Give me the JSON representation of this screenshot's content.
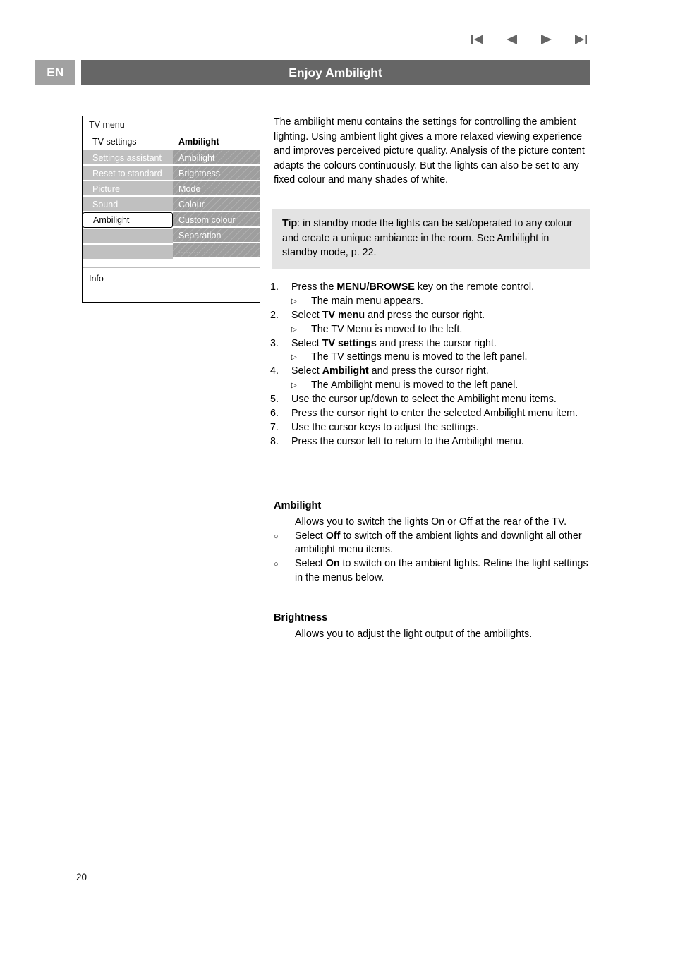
{
  "nav": {
    "icons": [
      {
        "name": "skip-first-icon",
        "label": "First page"
      },
      {
        "name": "previous-icon",
        "label": "Previous page"
      },
      {
        "name": "next-icon",
        "label": "Next page"
      },
      {
        "name": "skip-last-icon",
        "label": "Last page"
      }
    ]
  },
  "header": {
    "language": "EN",
    "title": "Enjoy Ambilight",
    "bar_color": "#666666",
    "badge_color": "#a1a1a1"
  },
  "tv_menu": {
    "title": "TV menu",
    "sub_left": "TV settings",
    "sub_right": "Ambilight",
    "left_items": [
      {
        "label": "Settings assistant",
        "selected": false
      },
      {
        "label": "Reset to standard",
        "selected": false
      },
      {
        "label": "Picture",
        "selected": false
      },
      {
        "label": "Sound",
        "selected": false
      },
      {
        "label": "Ambilight",
        "selected": true
      },
      {
        "label": "",
        "selected": false
      },
      {
        "label": "",
        "selected": false
      }
    ],
    "right_items": [
      {
        "label": "Ambilight"
      },
      {
        "label": "Brightness"
      },
      {
        "label": "Mode"
      },
      {
        "label": "Colour"
      },
      {
        "label": "Custom colour"
      },
      {
        "label": "Separation"
      },
      {
        "label": "............."
      }
    ],
    "info": "Info"
  },
  "intro": "The ambilight menu contains the settings for controlling the ambient lighting. Using ambient light gives a more relaxed viewing experience and improves perceived picture quality. Analysis of the picture content adapts the colours continuously. But the lights can also be set to any fixed colour and many shades of white.",
  "tip": {
    "label": "Tip",
    "text": ": in standby mode the lights can be set/operated to any colour and create a unique ambiance in the room.  See Ambilight in standby mode, p. 22.",
    "background": "#e3e3e3"
  },
  "steps": [
    {
      "num": "1.",
      "pre": "Press the ",
      "bold": "MENU/BROWSE",
      "post": " key on the remote control.",
      "sub": "The main menu appears."
    },
    {
      "num": "2.",
      "pre": "Select ",
      "bold": "TV menu",
      "post": " and press the cursor right.",
      "sub": "The TV Menu is moved to the left."
    },
    {
      "num": "3.",
      "pre": "Select ",
      "bold": "TV settings",
      "post": " and press the cursor right.",
      "sub": "The TV settings menu is moved to the left panel."
    },
    {
      "num": "4.",
      "pre": "Select ",
      "bold": "Ambilight",
      "post": " and press the cursor right.",
      "sub": "The Ambilight menu is moved to the left panel."
    },
    {
      "num": "5.",
      "pre": "Use the cursor up/down to select the Ambilight menu items.",
      "bold": "",
      "post": "",
      "sub": ""
    },
    {
      "num": "6.",
      "pre": "Press the cursor right to enter the selected Ambilight menu item.",
      "bold": "",
      "post": "",
      "sub": ""
    },
    {
      "num": "7.",
      "pre": "Use the cursor keys to adjust the settings.",
      "bold": "",
      "post": "",
      "sub": ""
    },
    {
      "num": "8.",
      "pre": "Press the cursor left to return to the Ambilight menu.",
      "bold": "",
      "post": "",
      "sub": ""
    }
  ],
  "sections": [
    {
      "title": "Ambilight",
      "para": "Allows you to switch the lights On or Off at the rear of the TV.",
      "bullets": [
        {
          "pre": "Select ",
          "bold": "Off",
          "post": " to switch off the ambient lights and downlight all other ambilight menu items."
        },
        {
          "pre": "Select ",
          "bold": "On",
          "post": " to switch on the ambient lights. Refine the light settings in the menus below."
        }
      ]
    },
    {
      "title": "Brightness",
      "para": "Allows you to adjust the light output of the ambilights.",
      "bullets": []
    }
  ],
  "page_number": "20"
}
